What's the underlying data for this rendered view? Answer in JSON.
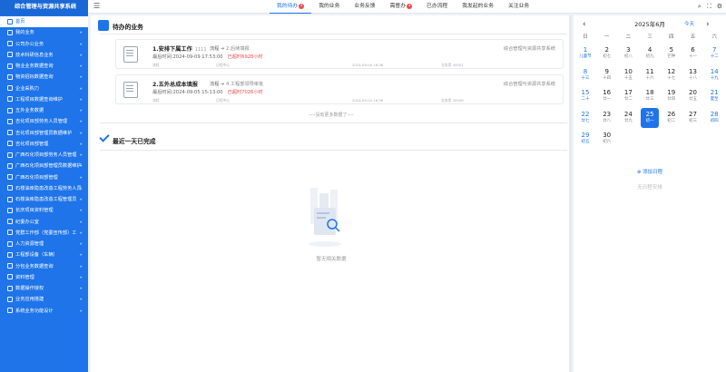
{
  "app": {
    "title": "综合管理与资源共享系统"
  },
  "sidebar": {
    "items": [
      {
        "label": "首页",
        "active": true,
        "chevron": false
      },
      {
        "label": "我的业务",
        "chevron": true
      },
      {
        "label": "公司办公业务",
        "chevron": true
      },
      {
        "label": "技术科研信息业务",
        "chevron": true
      },
      {
        "label": "物业业务数据查询",
        "chevron": true
      },
      {
        "label": "物资招标数据查询",
        "chevron": true
      },
      {
        "label": "企业采购力",
        "chevron": true
      },
      {
        "label": "工程项目数据查询维护",
        "chevron": true
      },
      {
        "label": "五外业务数据",
        "chevron": true
      },
      {
        "label": "吉化项目部劳务人员管理",
        "chevron": true
      },
      {
        "label": "吉化项目部管理员数据维护",
        "chevron": true
      },
      {
        "label": "吉化项目部管理",
        "chevron": true
      },
      {
        "label": "广西石化项目部劳务人员管理",
        "chevron": true
      },
      {
        "label": "广西石化项目部管理员数据维护",
        "chevron": true
      },
      {
        "label": "广西石化项目部管理",
        "chevron": true
      },
      {
        "label": "石楼油库隐患改造工程劳务人员",
        "chevron": true
      },
      {
        "label": "石楼油库隐患改造工程管理员",
        "chevron": true
      },
      {
        "label": "长庆项目资料管理",
        "chevron": true
      },
      {
        "label": "纪委办公室",
        "chevron": true
      },
      {
        "label": "党群工作部（党委宣传部）工",
        "chevron": true
      },
      {
        "label": "人力资源管理",
        "chevron": true
      },
      {
        "label": "工程部设备（车辆）",
        "chevron": true
      },
      {
        "label": "分包业务数据查询",
        "chevron": true
      },
      {
        "label": "资料管理",
        "chevron": true
      },
      {
        "label": "数据操作授权",
        "chevron": true
      },
      {
        "label": "业务应用搭建",
        "chevron": true
      },
      {
        "label": "系统业务功能设计",
        "chevron": true
      }
    ]
  },
  "topbar": {
    "tabs": [
      {
        "label": "我的待办",
        "badge": "2",
        "active": true
      },
      {
        "label": "我的业务",
        "badge": ""
      },
      {
        "label": "业务反馈",
        "badge": ""
      },
      {
        "label": "需督办",
        "badge": "3"
      },
      {
        "label": "已办流程",
        "badge": ""
      },
      {
        "label": "我发起的业务",
        "badge": ""
      },
      {
        "label": "关注业务",
        "badge": ""
      }
    ]
  },
  "todo": {
    "title": "待办的业务",
    "cards": [
      {
        "title": "1.安排下属工作",
        "subtitle": "1111",
        "flow_label": "流程",
        "flow_step": "2.后续填报",
        "org": "综合管理与资源共享系统",
        "deadline": "最后时间:2024-09-09 17:53:00",
        "overdue": "已超时6928小时",
        "meta": [
          "流程",
          "日程中心",
          "2024-09-04 16:36",
          "业务类 40001"
        ]
      },
      {
        "title": "2.五外总成本填报",
        "subtitle": "",
        "flow_label": "流程",
        "flow_step": "4.工程部领导审批",
        "org": "综合管理与资源共享系统",
        "deadline": "最后时间:2024-09-05 15:13:00",
        "overdue": "已超时7026小时",
        "meta": [
          "流程",
          "日程中心",
          "2024-09-04 16:36",
          "业务类 30006"
        ]
      }
    ],
    "no_more": "----没有更多数据了----"
  },
  "done": {
    "title": "最近一天已完成",
    "empty_text": "暂无相关数据"
  },
  "calendar": {
    "title": "2025年6月",
    "today_label": "今天",
    "weekdays": [
      "日",
      "一",
      "二",
      "三",
      "四",
      "五",
      "六"
    ],
    "days": [
      {
        "n": "1",
        "l": "儿童节"
      },
      {
        "n": "2",
        "l": "初七"
      },
      {
        "n": "3",
        "l": "初八"
      },
      {
        "n": "4",
        "l": "初九"
      },
      {
        "n": "5",
        "l": "芒种"
      },
      {
        "n": "6",
        "l": "十一"
      },
      {
        "n": "7",
        "l": "十二"
      },
      {
        "n": "8",
        "l": "十三"
      },
      {
        "n": "9",
        "l": "十四"
      },
      {
        "n": "10",
        "l": "十五"
      },
      {
        "n": "11",
        "l": "十六"
      },
      {
        "n": "12",
        "l": "十七"
      },
      {
        "n": "13",
        "l": "十八"
      },
      {
        "n": "14",
        "l": "十九"
      },
      {
        "n": "15",
        "l": "二十"
      },
      {
        "n": "16",
        "l": "廿一"
      },
      {
        "n": "17",
        "l": "廿二"
      },
      {
        "n": "18",
        "l": "廿三"
      },
      {
        "n": "19",
        "l": "廿四"
      },
      {
        "n": "20",
        "l": "廿五"
      },
      {
        "n": "21",
        "l": "夏至"
      },
      {
        "n": "22",
        "l": "廿七"
      },
      {
        "n": "23",
        "l": "廿八"
      },
      {
        "n": "24",
        "l": "廿九"
      },
      {
        "n": "25",
        "l": "初一"
      },
      {
        "n": "26",
        "l": "初二"
      },
      {
        "n": "27",
        "l": "初三"
      },
      {
        "n": "28",
        "l": "初四"
      },
      {
        "n": "29",
        "l": "初五"
      },
      {
        "n": "30",
        "l": "初六"
      }
    ],
    "first_weekday": 0,
    "selected": "25",
    "add_label": "添加日程",
    "empty_label": "无日程安排"
  },
  "colors": {
    "accent": "#1e74e8",
    "danger": "#f5484b",
    "sidebar": "#1e74e8"
  },
  "icons": {
    "collapse": "menu-fold-icon",
    "prev": "chevron-left-icon",
    "next": "chevron-right-icon"
  }
}
